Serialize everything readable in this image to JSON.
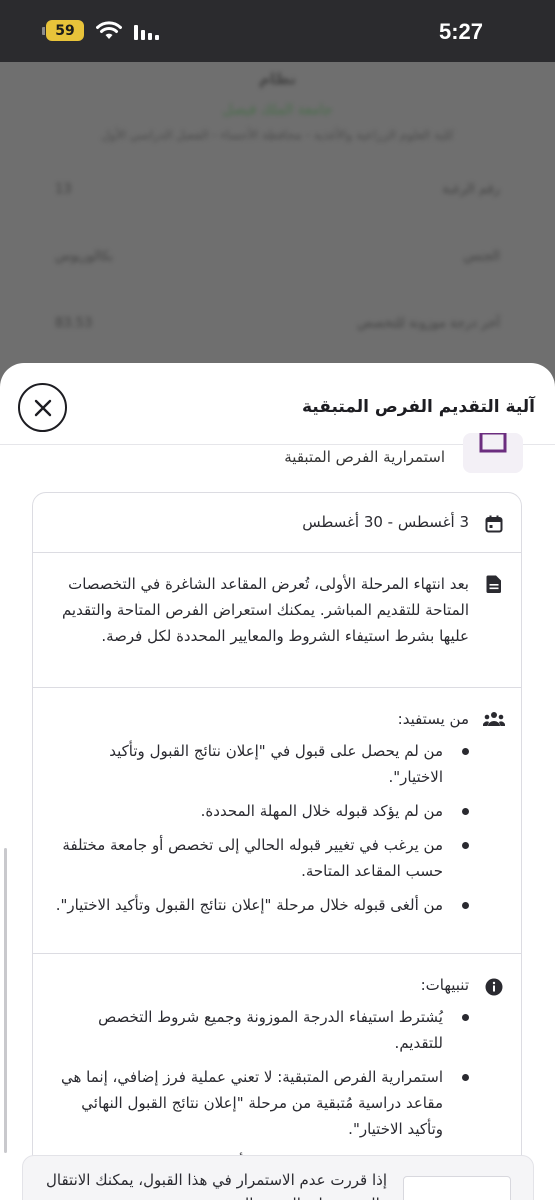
{
  "status_bar": {
    "battery": "59",
    "time": "5:27"
  },
  "background": {
    "title": "نظام",
    "subtitle_green": "جامعة الملك فيصل",
    "caption": "كلية العلوم الزراعية والأغذية - محافظة الأحساء - الفصل الدراسي الأول",
    "rows": [
      {
        "label": "رقم الرغبة",
        "value": "13"
      },
      {
        "label": "الجنس",
        "value": "بكالوريوس"
      },
      {
        "label": "آخر درجة موزونة للتخصص",
        "value": "83.53"
      }
    ]
  },
  "sheet": {
    "title": "آلية التقديم الفرص المتبقية",
    "phase_label": "استمرارية الفرص المتبقية",
    "date_range": "3 أغسطس - 30 أغسطس",
    "description": "بعد انتهاء المرحلة الأولى، تُعرض المقاعد الشاغرة في التخصصات المتاحة للتقديم المباشر. يمكنك استعراض الفرص المتاحة والتقديم عليها بشرط استيفاء الشروط والمعايير المحددة لكل فرصة.",
    "beneficiaries": {
      "heading": "من يستفيد:",
      "items": [
        "من لم يحصل على قبول في \"إعلان نتائج القبول وتأكيد الاختيار\".",
        "من لم يؤكد قبوله خلال المهلة المحددة.",
        "من يرغب في تغيير قبوله الحالي إلى تخصص أو جامعة مختلفة حسب المقاعد المتاحة.",
        "من ألغى قبوله خلال مرحلة \"إعلان نتائج القبول وتأكيد الاختيار\"."
      ]
    },
    "notes": {
      "heading": "تنبيهات:",
      "items": [
        "يُشترط استيفاء الدرجة الموزونة وجميع شروط التخصص للتقديم.",
        "استمرارية الفرص المتبقية: لا تعني عملية فرز إضافي، إنما هي مقاعد دراسية مُتبقية من مرحلة \"إعلان نتائج القبول النهائي وتأكيد الاختيار\".",
        "لا يمكن التراجع عن الاختيار بعد تأكيده."
      ]
    }
  },
  "banner": {
    "text": "إذا قررت عدم الاستمرار في هذا القبول، يمكنك الانتقال والتقديم على الفرص المتبقية"
  },
  "colors": {
    "status_bg": "#2b2b2e",
    "battery": "#e8c33a",
    "overlay": "#6f6f6f",
    "text": "#2a2a30",
    "phase_icon": "#6b2d7f"
  }
}
